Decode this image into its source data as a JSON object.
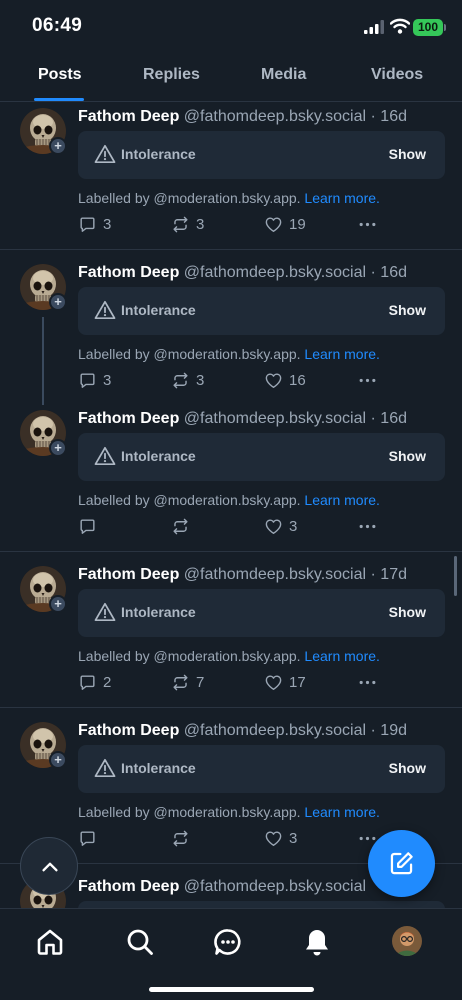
{
  "status_bar": {
    "time": "06:49",
    "battery": "100"
  },
  "tabs": [
    {
      "label": "Posts",
      "active": true
    },
    {
      "label": "Replies",
      "active": false
    },
    {
      "label": "Media",
      "active": false
    },
    {
      "label": "Videos",
      "active": false
    }
  ],
  "posts": [
    {
      "name": "Fathom Deep",
      "handle": "@fathomdeep.bsky.social",
      "time": "· 16d",
      "label": "Intolerance",
      "show": "Show",
      "labelled_by": "Labelled by @moderation.bsky.app.",
      "learn_more": "Learn more.",
      "replies": "3",
      "reposts": "3",
      "likes": "19"
    },
    {
      "name": "Fathom Deep",
      "handle": "@fathomdeep.bsky.social",
      "time": "· 16d",
      "label": "Intolerance",
      "show": "Show",
      "labelled_by": "Labelled by @moderation.bsky.app.",
      "learn_more": "Learn more.",
      "replies": "3",
      "reposts": "3",
      "likes": "16"
    },
    {
      "name": "Fathom Deep",
      "handle": "@fathomdeep.bsky.social",
      "time": "· 16d",
      "label": "Intolerance",
      "show": "Show",
      "labelled_by": "Labelled by @moderation.bsky.app.",
      "learn_more": "Learn more.",
      "replies": "",
      "reposts": "",
      "likes": "3"
    },
    {
      "name": "Fathom Deep",
      "handle": "@fathomdeep.bsky.social",
      "time": "· 17d",
      "label": "Intolerance",
      "show": "Show",
      "labelled_by": "Labelled by @moderation.bsky.app.",
      "learn_more": "Learn more.",
      "replies": "2",
      "reposts": "7",
      "likes": "17"
    },
    {
      "name": "Fathom Deep",
      "handle": "@fathomdeep.bsky.social",
      "time": "· 19d",
      "label": "Intolerance",
      "show": "Show",
      "labelled_by": "Labelled by @moderation.bsky.app.",
      "learn_more": "Learn more.",
      "replies": "",
      "reposts": "",
      "likes": "3"
    },
    {
      "name": "Fathom Deep",
      "handle": "@fathomdeep.bsky.social",
      "time": ""
    }
  ],
  "nav": [
    "home-icon",
    "search-icon",
    "chat-icon",
    "notifications-icon",
    "profile-avatar"
  ],
  "colors": {
    "accent": "#208bfe",
    "background": "#161e27",
    "card": "#1f2a37"
  }
}
